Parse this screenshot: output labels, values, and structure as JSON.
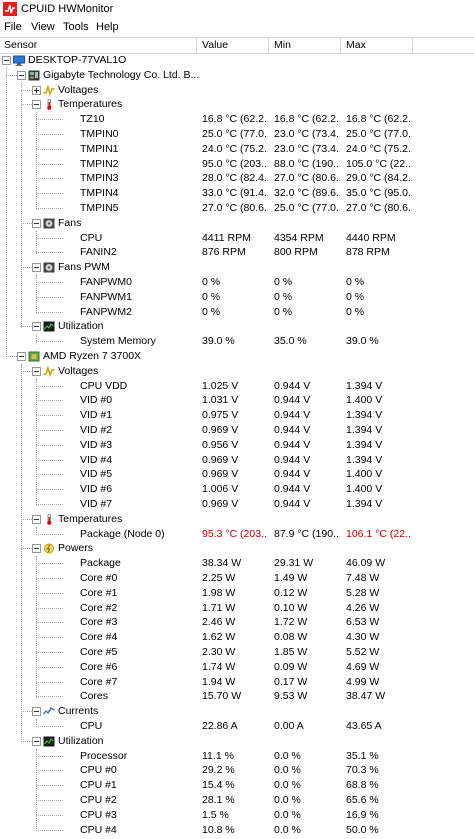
{
  "window": {
    "title": "CPUID HWMonitor"
  },
  "menu": [
    "File",
    "View",
    "Tools",
    "Help"
  ],
  "columns": {
    "sensor": "Sensor",
    "value": "Value",
    "min": "Min",
    "max": "Max"
  },
  "rows": [
    {
      "level": 0,
      "type": "node",
      "icon": "computer-icon",
      "label": "DESKTOP-77VAL1O",
      "exp": "minus"
    },
    {
      "level": 1,
      "type": "node",
      "icon": "motherboard-icon",
      "label": "Gigabyte Technology Co. Ltd. B...",
      "exp": "minus"
    },
    {
      "level": 2,
      "type": "node",
      "icon": "voltage-icon",
      "label": "Voltages",
      "exp": "plus"
    },
    {
      "level": 2,
      "type": "node",
      "icon": "thermometer-icon",
      "label": "Temperatures",
      "exp": "minus"
    },
    {
      "level": 3,
      "type": "leaf",
      "label": "TZ10",
      "value": "16.8 °C  (62.2...",
      "min": "16.8 °C  (62.2...",
      "max": "16.8 °C  (62.2..."
    },
    {
      "level": 3,
      "type": "leaf",
      "label": "TMPIN0",
      "value": "25.0 °C  (77.0...",
      "min": "23.0 °C  (73.4...",
      "max": "25.0 °C  (77.0..."
    },
    {
      "level": 3,
      "type": "leaf",
      "label": "TMPIN1",
      "value": "24.0 °C  (75.2...",
      "min": "23.0 °C  (73.4...",
      "max": "24.0 °C  (75.2..."
    },
    {
      "level": 3,
      "type": "leaf",
      "label": "TMPIN2",
      "value": "95.0 °C  (203....",
      "min": "88.0 °C  (190....",
      "max": "105.0 °C  (22..."
    },
    {
      "level": 3,
      "type": "leaf",
      "label": "TMPIN3",
      "value": "28.0 °C  (82.4...",
      "min": "27.0 °C  (80.6...",
      "max": "29.0 °C  (84.2..."
    },
    {
      "level": 3,
      "type": "leaf",
      "label": "TMPIN4",
      "value": "33.0 °C  (91.4...",
      "min": "32.0 °C  (89.6...",
      "max": "35.0 °C  (95.0..."
    },
    {
      "level": 3,
      "type": "leaf",
      "label": "TMPIN5",
      "value": "27.0 °C  (80.6...",
      "min": "25.0 °C  (77.0...",
      "max": "27.0 °C  (80.6..."
    },
    {
      "level": 2,
      "type": "node",
      "icon": "fan-icon",
      "label": "Fans",
      "exp": "minus"
    },
    {
      "level": 3,
      "type": "leaf",
      "label": "CPU",
      "value": "4411 RPM",
      "min": "4354 RPM",
      "max": "4440 RPM"
    },
    {
      "level": 3,
      "type": "leaf",
      "label": "FANIN2",
      "value": "876 RPM",
      "min": "800 RPM",
      "max": "878 RPM"
    },
    {
      "level": 2,
      "type": "node",
      "icon": "fan-icon",
      "label": "Fans PWM",
      "exp": "minus"
    },
    {
      "level": 3,
      "type": "leaf",
      "label": "FANPWM0",
      "value": "0 %",
      "min": "0 %",
      "max": "0 %"
    },
    {
      "level": 3,
      "type": "leaf",
      "label": "FANPWM1",
      "value": "0 %",
      "min": "0 %",
      "max": "0 %"
    },
    {
      "level": 3,
      "type": "leaf",
      "label": "FANPWM2",
      "value": "0 %",
      "min": "0 %",
      "max": "0 %"
    },
    {
      "level": 2,
      "type": "node",
      "icon": "utilization-icon",
      "label": "Utilization",
      "exp": "minus"
    },
    {
      "level": 3,
      "type": "leaf",
      "label": "System Memory",
      "value": "39.0 %",
      "min": "35.0 %",
      "max": "39.0 %"
    },
    {
      "level": 1,
      "type": "node",
      "icon": "cpu-chip-icon",
      "label": "AMD Ryzen 7 3700X",
      "exp": "minus"
    },
    {
      "level": 2,
      "type": "node",
      "icon": "voltage-icon",
      "label": "Voltages",
      "exp": "minus"
    },
    {
      "level": 3,
      "type": "leaf",
      "label": "CPU VDD",
      "value": "1.025 V",
      "min": "0.944 V",
      "max": "1.394 V"
    },
    {
      "level": 3,
      "type": "leaf",
      "label": "VID #0",
      "value": "1.031 V",
      "min": "0.944 V",
      "max": "1.400 V"
    },
    {
      "level": 3,
      "type": "leaf",
      "label": "VID #1",
      "value": "0.975 V",
      "min": "0.944 V",
      "max": "1.394 V"
    },
    {
      "level": 3,
      "type": "leaf",
      "label": "VID #2",
      "value": "0.969 V",
      "min": "0.944 V",
      "max": "1.394 V"
    },
    {
      "level": 3,
      "type": "leaf",
      "label": "VID #3",
      "value": "0.956 V",
      "min": "0.944 V",
      "max": "1.394 V"
    },
    {
      "level": 3,
      "type": "leaf",
      "label": "VID #4",
      "value": "0.969 V",
      "min": "0.944 V",
      "max": "1.394 V"
    },
    {
      "level": 3,
      "type": "leaf",
      "label": "VID #5",
      "value": "0.969 V",
      "min": "0.944 V",
      "max": "1.400 V"
    },
    {
      "level": 3,
      "type": "leaf",
      "label": "VID #6",
      "value": "1.006 V",
      "min": "0.944 V",
      "max": "1.400 V"
    },
    {
      "level": 3,
      "type": "leaf",
      "label": "VID #7",
      "value": "0.969 V",
      "min": "0.944 V",
      "max": "1.394 V"
    },
    {
      "level": 2,
      "type": "node",
      "icon": "thermometer-icon",
      "label": "Temperatures",
      "exp": "minus"
    },
    {
      "level": 3,
      "type": "leaf",
      "label": "Package (Node 0)",
      "value": "95.3 °C  (203....",
      "min": "87.9 °C  (190....",
      "max": "106.1 °C  (22...",
      "red_value": true,
      "red_max": true
    },
    {
      "level": 2,
      "type": "node",
      "icon": "power-icon",
      "label": "Powers",
      "exp": "minus"
    },
    {
      "level": 3,
      "type": "leaf",
      "label": "Package",
      "value": "38.34 W",
      "min": "29.31 W",
      "max": "46.09 W"
    },
    {
      "level": 3,
      "type": "leaf",
      "label": "Core #0",
      "value": "2.25 W",
      "min": "1.49 W",
      "max": "7.48 W"
    },
    {
      "level": 3,
      "type": "leaf",
      "label": "Core #1",
      "value": "1.98 W",
      "min": "0.12 W",
      "max": "5.28 W"
    },
    {
      "level": 3,
      "type": "leaf",
      "label": "Core #2",
      "value": "1.71 W",
      "min": "0.10 W",
      "max": "4.26 W"
    },
    {
      "level": 3,
      "type": "leaf",
      "label": "Core #3",
      "value": "2.46 W",
      "min": "1.72 W",
      "max": "6.53 W"
    },
    {
      "level": 3,
      "type": "leaf",
      "label": "Core #4",
      "value": "1.62 W",
      "min": "0.08 W",
      "max": "4.30 W"
    },
    {
      "level": 3,
      "type": "leaf",
      "label": "Core #5",
      "value": "2.30 W",
      "min": "1.85 W",
      "max": "5.52 W"
    },
    {
      "level": 3,
      "type": "leaf",
      "label": "Core #6",
      "value": "1.74 W",
      "min": "0.09 W",
      "max": "4.69 W"
    },
    {
      "level": 3,
      "type": "leaf",
      "label": "Core #7",
      "value": "1.94 W",
      "min": "0.17 W",
      "max": "4.99 W"
    },
    {
      "level": 3,
      "type": "leaf",
      "label": "Cores",
      "value": "15.70 W",
      "min": "9.53 W",
      "max": "38.47 W"
    },
    {
      "level": 2,
      "type": "node",
      "icon": "current-icon",
      "label": "Currents",
      "exp": "minus"
    },
    {
      "level": 3,
      "type": "leaf",
      "label": "CPU",
      "value": "22.86 A",
      "min": "0.00 A",
      "max": "43.65 A"
    },
    {
      "level": 2,
      "type": "node",
      "icon": "utilization-icon",
      "label": "Utilization",
      "exp": "minus"
    },
    {
      "level": 3,
      "type": "leaf",
      "label": "Processor",
      "value": "11.1 %",
      "min": "0.0 %",
      "max": "35.1 %"
    },
    {
      "level": 3,
      "type": "leaf",
      "label": "CPU #0",
      "value": "29.2 %",
      "min": "0.0 %",
      "max": "70.3 %"
    },
    {
      "level": 3,
      "type": "leaf",
      "label": "CPU #1",
      "value": "15.4 %",
      "min": "0.0 %",
      "max": "68.8 %"
    },
    {
      "level": 3,
      "type": "leaf",
      "label": "CPU #2",
      "value": "28.1 %",
      "min": "0.0 %",
      "max": "65.6 %"
    },
    {
      "level": 3,
      "type": "leaf",
      "label": "CPU #3",
      "value": "1.5 %",
      "min": "0.0 %",
      "max": "16.9 %"
    },
    {
      "level": 3,
      "type": "leaf",
      "label": "CPU #4",
      "value": "10.8 %",
      "min": "0.0 %",
      "max": "50.0 %"
    }
  ],
  "colors": {
    "alarm": "#c00000",
    "grid": "#d9d9d9",
    "tree_line": "#a0a0a0"
  }
}
